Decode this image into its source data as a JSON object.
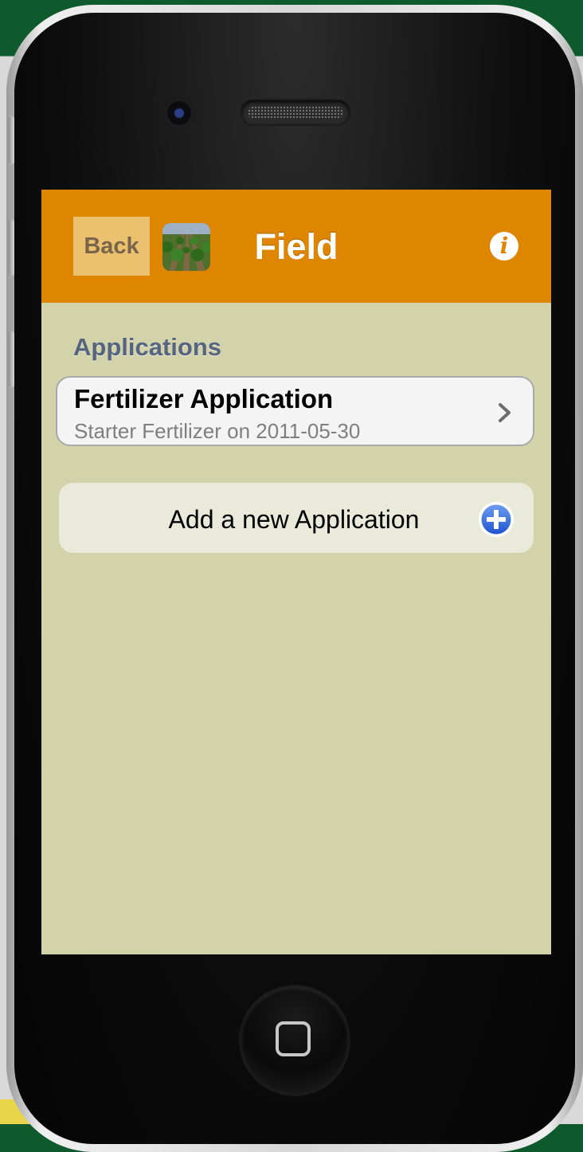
{
  "navbar": {
    "back_label": "Back",
    "title": "Field",
    "info_icon": "info-icon",
    "info_glyph": "i",
    "color": "#de8600",
    "back_color": "#ebc06f"
  },
  "content": {
    "background": "#d3d3ab",
    "section_header": "Applications",
    "applications": [
      {
        "title": "Fertilizer Application",
        "subtitle": "Starter Fertilizer on 2011-05-30",
        "accessory_icon": "chevron-right-icon"
      }
    ],
    "add_button_label": "Add a new Application",
    "add_icon": "plus-circle-icon"
  },
  "device": {
    "home_icon": "home-button-icon"
  }
}
